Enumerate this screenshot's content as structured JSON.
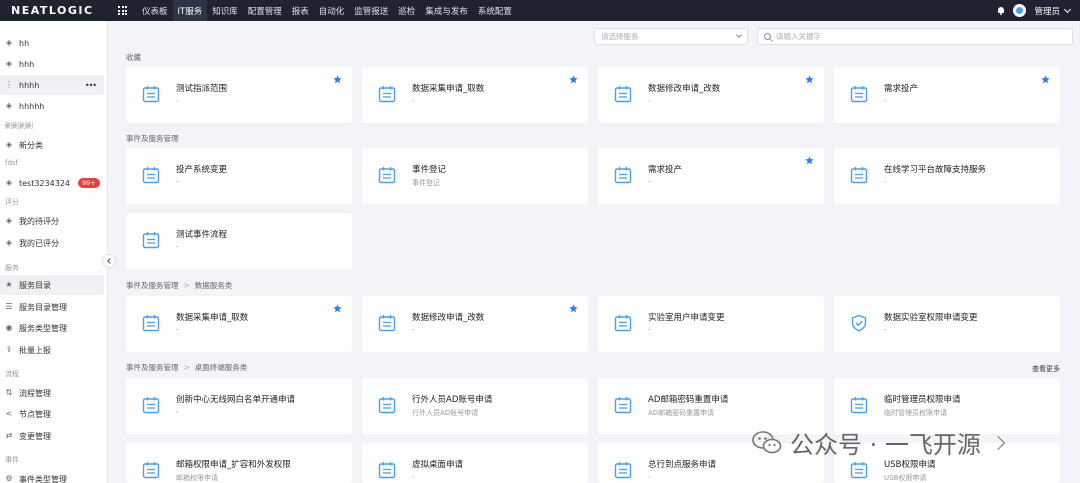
{
  "app": {
    "logo": "NEATLOGIC"
  },
  "nav": [
    "仪表板",
    "IT服务",
    "知识库",
    "配置管理",
    "报表",
    "自动化",
    "监管报送",
    "巡检",
    "集成与发布",
    "系统配置"
  ],
  "user": {
    "name": "管理员"
  },
  "sidebar": {
    "items": [
      {
        "label": "hh",
        "icon": "tag-icon"
      },
      {
        "label": "hhh",
        "icon": "tag-icon"
      },
      {
        "label": "hhhh",
        "icon": "drag-icon",
        "more": "•••"
      },
      {
        "label": "hhhhh",
        "icon": "tag-icon"
      },
      {
        "label": "新分类",
        "icon": "tag-icon"
      },
      {
        "label": "test3234324",
        "icon": "tag-icon",
        "badge": "99+"
      },
      {
        "label": "我的待评分",
        "icon": "tag-icon"
      },
      {
        "label": "我的已评分",
        "icon": "tag-icon"
      },
      {
        "label": "服务目录",
        "icon": "star-icon"
      },
      {
        "label": "服务目录管理",
        "icon": "list-icon"
      },
      {
        "label": "服务类型管理",
        "icon": "play-circle-icon"
      },
      {
        "label": "批量上报",
        "icon": "upload-icon"
      },
      {
        "label": "流程管理",
        "icon": "flow-icon"
      },
      {
        "label": "节点管理",
        "icon": "share-icon"
      },
      {
        "label": "变更管理",
        "icon": "swap-icon"
      },
      {
        "label": "事件类型管理",
        "icon": "settings-icon"
      }
    ],
    "groups": [
      "刷刷刷刷",
      "fdsf",
      "评分",
      "服务",
      "流程",
      "事件"
    ]
  },
  "filters": {
    "service_placeholder": "请选择服务",
    "search_placeholder": "请输入关键字"
  },
  "sections": [
    {
      "crumbs": [
        "收藏"
      ]
    },
    {
      "crumbs": [
        "事件及服务管理"
      ]
    },
    {
      "crumbs": [
        "事件及服务管理",
        "数据服务类"
      ]
    },
    {
      "crumbs": [
        "事件及服务管理",
        "桌面终端服务类"
      ],
      "more": "查看更多"
    }
  ],
  "cards": [
    {
      "title": "测试指派范围",
      "sub": "-",
      "star": true,
      "icon": "calendar-icon"
    },
    {
      "title": "数据采集申请_取数",
      "sub": "-",
      "star": true,
      "icon": "calendar-icon"
    },
    {
      "title": "数据修改申请_改数",
      "sub": "-",
      "star": true,
      "icon": "calendar-icon"
    },
    {
      "title": "需求投产",
      "sub": "-",
      "star": true,
      "icon": "calendar-icon"
    },
    {
      "title": "投产系统变更",
      "sub": "-",
      "star": false,
      "icon": "calendar-icon"
    },
    {
      "title": "事件登记",
      "sub": "事件登记",
      "star": false,
      "icon": "calendar-icon"
    },
    {
      "title": "需求投产",
      "sub": "-",
      "star": true,
      "icon": "calendar-icon"
    },
    {
      "title": "在线学习平台故障支持服务",
      "sub": "-",
      "star": false,
      "icon": "calendar-icon"
    },
    {
      "title": "测试事件流程",
      "sub": "-",
      "star": false,
      "icon": "calendar-icon"
    },
    {
      "title": "数据采集申请_取数",
      "sub": "-",
      "star": true,
      "icon": "calendar-icon"
    },
    {
      "title": "数据修改申请_改数",
      "sub": "-",
      "star": true,
      "icon": "calendar-icon"
    },
    {
      "title": "实验室用户申请变更",
      "sub": "-",
      "star": false,
      "icon": "calendar-icon"
    },
    {
      "title": "数据实验室权限申请变更",
      "sub": "-",
      "star": false,
      "icon": "shield-icon"
    },
    {
      "title": "创新中心无线网白名单开通申请",
      "sub": "-",
      "star": false,
      "icon": "calendar-icon"
    },
    {
      "title": "行外人员AD账号申请",
      "sub": "行外人员AD账号申请",
      "star": false,
      "icon": "calendar-icon"
    },
    {
      "title": "AD邮箱密码重置申请",
      "sub": "AD邮箱密码重置申请",
      "star": false,
      "icon": "calendar-icon"
    },
    {
      "title": "临时管理员权限申请",
      "sub": "临时管理员权限申请",
      "star": false,
      "icon": "calendar-icon"
    },
    {
      "title": "邮箱权限申请_扩容和外发权限",
      "sub": "邮箱权限申请",
      "star": false,
      "icon": "calendar-icon"
    },
    {
      "title": "虚拟桌面申请",
      "sub": "-",
      "star": false,
      "icon": "calendar-icon"
    },
    {
      "title": "总行到点服务申请",
      "sub": "-",
      "star": false,
      "icon": "calendar-icon"
    },
    {
      "title": "USB权限申请",
      "sub": "USB权限申请",
      "star": false,
      "icon": "calendar-icon"
    }
  ],
  "watermark": "公众号 · 一飞开源",
  "colors": {
    "topbar": "#1f2330",
    "accent": "#2d7ff9",
    "icon": "#4aa0f0",
    "badge": "#e8403a"
  }
}
